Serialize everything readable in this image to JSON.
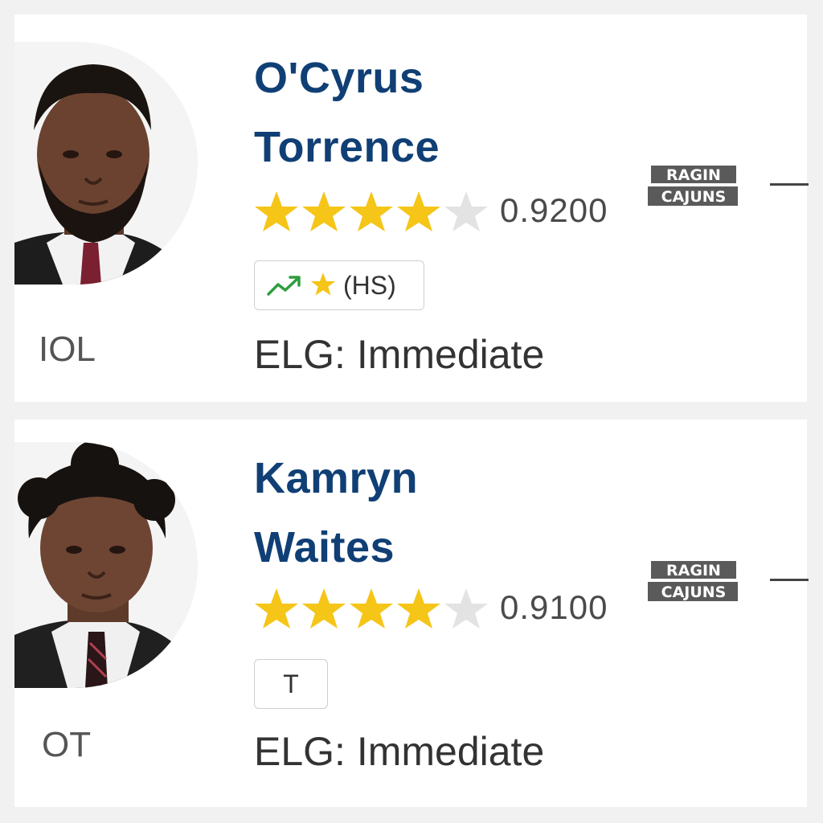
{
  "players": [
    {
      "first_name": "O'Cyrus",
      "last_name": "Torrence",
      "position": "IOL",
      "rating": "0.9200",
      "stars_filled": 4,
      "stars_total": 5,
      "badge_text": "(HS)",
      "badge_icons": [
        "trending-up-icon",
        "star-icon"
      ],
      "eligibility": "ELG: Immediate",
      "team_logo_text": [
        "RAGIN",
        "CAJUNS"
      ]
    },
    {
      "first_name": "Kamryn",
      "last_name": "Waites",
      "position": "OT",
      "rating": "0.9100",
      "stars_filled": 4,
      "stars_total": 5,
      "badge_text": "T",
      "badge_icons": [],
      "eligibility": "ELG: Immediate",
      "team_logo_text": [
        "RAGIN",
        "CAJUNS"
      ]
    }
  ],
  "colors": {
    "name": "#103f75",
    "star_filled": "#f5c518",
    "star_empty": "#e3e3e3",
    "trend_green": "#2e9e3e",
    "background": "#f1f1f1",
    "card": "#ffffff"
  }
}
